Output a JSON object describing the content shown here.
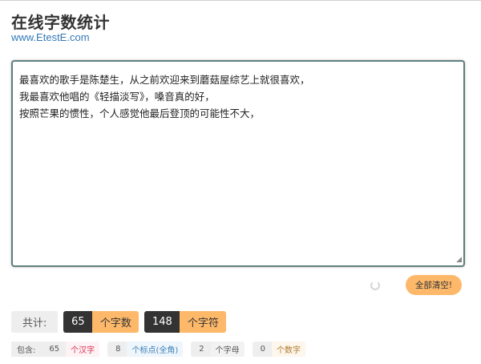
{
  "header": {
    "title": "在线字数统计",
    "site": "www.EtestE.com"
  },
  "editor": {
    "lines": [
      "最喜欢的歌手是陈楚生，从之前欢迎来到蘑菇屋综艺上就很喜欢，",
      "我最喜欢他唱的《轻描淡写》，嗓音真的好，",
      "按照芒果的惯性，个人感觉他最后登顶的可能性不大，"
    ]
  },
  "actions": {
    "clear_label": "全部清空!"
  },
  "stats": {
    "total_label": "共计:",
    "chars_count": "65",
    "chars_unit": "个字数",
    "symbols_count": "148",
    "symbols_unit": "个字符"
  },
  "breakdown": {
    "label": "包含:",
    "hanzi_count": "65",
    "hanzi_unit": "个汉字",
    "punct_count": "8",
    "punct_unit": "个标点(全角)",
    "letter_count": "2",
    "letter_unit": "个字母",
    "digit_count": "0",
    "digit_unit": "个数字"
  }
}
